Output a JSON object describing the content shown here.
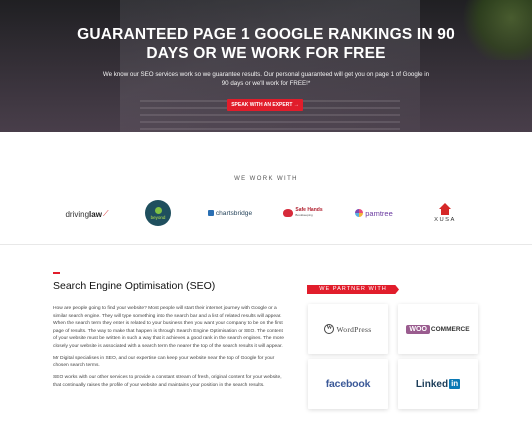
{
  "hero": {
    "title": "GUARANTEED PAGE 1 GOOGLE RANKINGS IN 90 DAYS OR WE WORK FOR FREE",
    "subtitle": "We know our SEO services work so we guarantee results. Our personal guaranteed will get you on page 1 of Google in 90 days or we'll work for FREE!*",
    "cta_label": "SPEAK WITH AN EXPERT →"
  },
  "we_work_with": {
    "heading": "WE WORK WITH",
    "logos": [
      {
        "name": "drivinglaw",
        "text_a": "driving",
        "text_b": "law"
      },
      {
        "name": "beyond",
        "text": "beyond"
      },
      {
        "name": "chartsbridge",
        "text": "chartsbridge"
      },
      {
        "name": "safe-hands",
        "text": "Safe Hands",
        "subtext": "Bookkeeping"
      },
      {
        "name": "pamtree",
        "text": "pamtree"
      },
      {
        "name": "xusa",
        "text": "XUSA"
      }
    ]
  },
  "seo": {
    "title": "Search Engine Optimisation (SEO)",
    "paragraphs": [
      "How are people going to find your website? Most people will start their internet journey with Google or a similar search engine. They will type something into the search bar and a list of related results will appear. When the search term they enter is related to your business then you want your company to be on the first page of results. The way to make that happen is through Search Engine Optimisation or SEO. The content of your website must be written in such a way that it achieves a good rank in the search engines. The more closely your website is associated with a search term the nearer the top of the search results it will appear.",
      "Mr Digital specialises in SEO, and our expertise can keep your website near the top of Google for your chosen search terms.",
      "SEO works with our other services to provide a constant stream of fresh, original content for your website, that continually raises the profile of your website and maintains your position in the search results."
    ]
  },
  "partners": {
    "heading": "WE PARTNER WITH",
    "wordpress": "WordPress",
    "woo_a": "WOO",
    "woo_b": "COMMERCE",
    "facebook": "facebook",
    "linkedin_a": "Linked",
    "linkedin_b": "in"
  }
}
